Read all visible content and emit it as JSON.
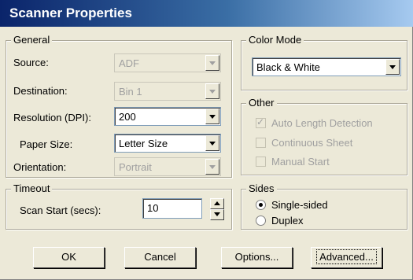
{
  "title": "Scanner Properties",
  "general": {
    "legend": "General",
    "source": {
      "label": "Source:",
      "value": "ADF"
    },
    "destination": {
      "label": "Destination:",
      "value": "Bin 1"
    },
    "resolution": {
      "label": "Resolution (DPI):",
      "value": "200"
    },
    "paper_size": {
      "label": "Paper Size:",
      "value": "Letter Size"
    },
    "orientation": {
      "label": "Orientation:",
      "value": "Portrait"
    }
  },
  "color_mode": {
    "legend": "Color Mode",
    "value": "Black & White"
  },
  "other": {
    "legend": "Other",
    "auto_length": {
      "label": "Auto Length Detection",
      "checked": true
    },
    "continuous_sheet": {
      "label": "Continuous Sheet",
      "checked": false
    },
    "manual_start": {
      "label": "Manual Start",
      "checked": false
    }
  },
  "timeout": {
    "legend": "Timeout",
    "label": "Scan Start (secs):",
    "value": "10"
  },
  "sides": {
    "legend": "Sides",
    "single": {
      "label": "Single-sided",
      "selected": true
    },
    "duplex": {
      "label": "Duplex",
      "selected": false
    }
  },
  "buttons": {
    "ok": "OK",
    "cancel": "Cancel",
    "options": "Options...",
    "advanced": "Advanced..."
  }
}
